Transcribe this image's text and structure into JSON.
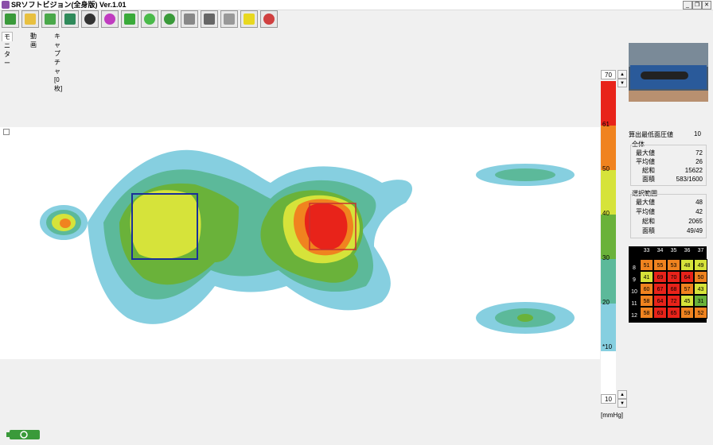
{
  "window": {
    "title": "SRソフトビジョン(全身版) Ver.1.01"
  },
  "tabs": [
    "モニター",
    "動画",
    "キャプチャ [0枚]"
  ],
  "scale": {
    "max_value": "70",
    "min_value": "10",
    "unit": "[mmHg]",
    "ticks": [
      "61",
      "50",
      "40",
      "30",
      "20",
      "*10"
    ],
    "colors": [
      "#e8231a",
      "#f0831f",
      "#d6e33a",
      "#6ab23a",
      "#5cb99a",
      "#86cfe0"
    ]
  },
  "stats": {
    "threshold_label": "算出最低面圧値",
    "threshold_value": "10",
    "overall_title": "全体",
    "overall": [
      {
        "k": "最大値",
        "v": "72"
      },
      {
        "k": "平均値",
        "v": "26"
      },
      {
        "k": "総和",
        "v": "15622"
      },
      {
        "k": "面積",
        "v": "583/1600"
      }
    ],
    "selection_title": "選択範囲",
    "selection": [
      {
        "k": "最大値",
        "v": "48"
      },
      {
        "k": "平均値",
        "v": "42"
      },
      {
        "k": "総和",
        "v": "2065"
      },
      {
        "k": "面積",
        "v": "49/49"
      }
    ]
  },
  "grid": {
    "cols": [
      "33",
      "34",
      "35",
      "36",
      "37"
    ],
    "rows": [
      "8",
      "9",
      "10",
      "11",
      "12"
    ],
    "values": [
      [
        "51",
        "55",
        "53",
        "48",
        "49"
      ],
      [
        "41",
        "69",
        "70",
        "64",
        "50"
      ],
      [
        "60",
        "67",
        "68",
        "57",
        "43"
      ],
      [
        "58",
        "64",
        "72",
        "45",
        "31"
      ],
      [
        "58",
        "63",
        "65",
        "59",
        "52"
      ]
    ]
  },
  "icons": [
    "lv-icon",
    "folder-icon",
    "updown-icon",
    "numbers-icon",
    "contrast-icon",
    "color-wheel-icon",
    "select-icon",
    "zoom-icon",
    "rotate-icon",
    "camera-icon",
    "video-icon",
    "wrench-icon",
    "help-icon",
    "webcam-icon"
  ]
}
